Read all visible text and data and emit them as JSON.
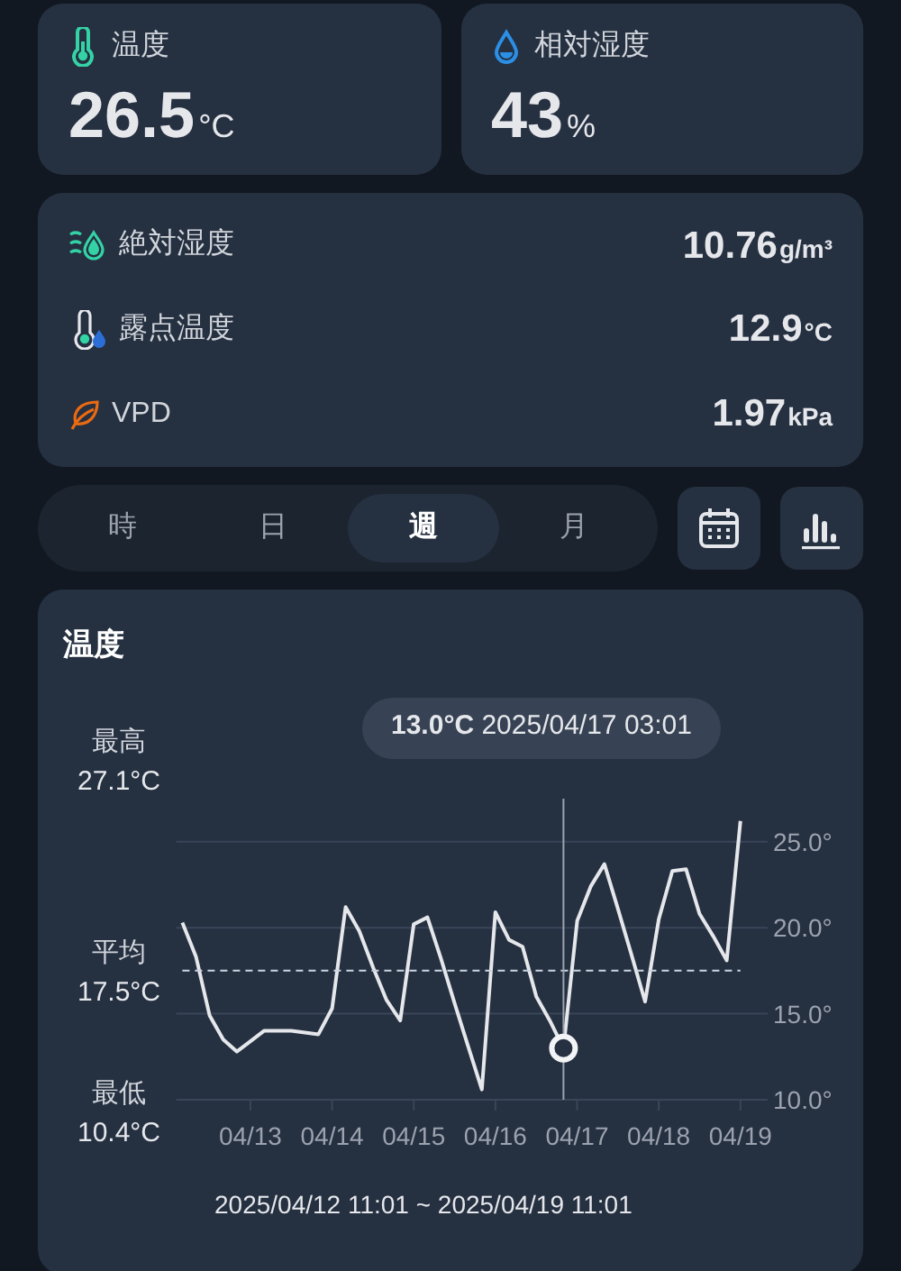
{
  "top_cards": [
    {
      "kind": "thermometer",
      "label": "温度",
      "value": "26.5",
      "unit": "°C"
    },
    {
      "kind": "drop",
      "label": "相対湿度",
      "value": "43",
      "unit": "%"
    }
  ],
  "metrics": [
    {
      "kind": "waves",
      "label": "絶対湿度",
      "value": "10.76",
      "unit": "g/m³"
    },
    {
      "kind": "dew",
      "label": "露点温度",
      "value": "12.9",
      "unit": "°C"
    },
    {
      "kind": "leaf",
      "label": "VPD",
      "value": "1.97",
      "unit": "kPa"
    }
  ],
  "period_tabs": [
    {
      "label": "時",
      "selected": false
    },
    {
      "label": "日",
      "selected": false
    },
    {
      "label": "週",
      "selected": true
    },
    {
      "label": "月",
      "selected": false
    }
  ],
  "chart_card": {
    "tooltip": {
      "value": "13.0°C",
      "time": "2025/04/17 03:01"
    },
    "stats": [
      {
        "label": "最高",
        "value": "27.1°C"
      },
      {
        "value": "17.5°C"
      },
      {
        "label": "最低",
        "value": "10.4°C"
      }
    ],
    "range": "2025/04/12 11:01 ~ 2025/04/19 11:01",
    "chart_data": {
      "type": "line",
      "title": "温度",
      "ylim": [
        10,
        27.5
      ],
      "categories": [
        null,
        null,
        null,
        null,
        null,
        "04/13",
        null,
        null,
        null,
        null,
        null,
        "04/14",
        null,
        null,
        null,
        null,
        null,
        "04/15",
        null,
        null,
        null,
        null,
        null,
        "04/16",
        null,
        null,
        null,
        null,
        null,
        "04/17",
        null,
        null,
        null,
        null,
        null,
        "04/18",
        null,
        null,
        null,
        null,
        null,
        "04/19"
      ],
      "yticks": [
        {
          "value": 10,
          "label": "10.0°"
        },
        {
          "value": 15,
          "label": "15.0°"
        },
        {
          "value": 20,
          "label": "20.0°"
        },
        {
          "value": 25,
          "label": "25.0°"
        }
      ],
      "series": [
        {
          "color": "#e5e7eb",
          "values": [
            20.3,
            18.3,
            14.9,
            13.5,
            12.8,
            13.4,
            14.0,
            14.0,
            14.0,
            13.9,
            13.8,
            15.3,
            21.2,
            19.8,
            17.7,
            15.8,
            14.6,
            20.2,
            20.6,
            18.2,
            15.6,
            13.1,
            10.6,
            20.9,
            19.3,
            18.9,
            16.0,
            14.6,
            13.0,
            20.4,
            22.4,
            23.7,
            21.1,
            18.4,
            15.7,
            20.5,
            23.3,
            23.4,
            20.8,
            19.5,
            18.1,
            26.2
          ]
        },
        {
          "name": "平均",
          "color": "#cbd5e1",
          "line_style": "dashed",
          "values": [
            17.5,
            17.5,
            17.5,
            17.5,
            17.5,
            17.5,
            17.5,
            17.5,
            17.5,
            17.5,
            17.5,
            17.5,
            17.5,
            17.5,
            17.5,
            17.5,
            17.5,
            17.5,
            17.5,
            17.5,
            17.5,
            17.5,
            17.5,
            17.5,
            17.5,
            17.5,
            17.5,
            17.5,
            17.5,
            17.5,
            17.5,
            17.5,
            17.5,
            17.5,
            17.5,
            17.5,
            17.5,
            17.5,
            17.5,
            17.5,
            17.5,
            17.5
          ]
        }
      ],
      "grid": true
    }
  }
}
